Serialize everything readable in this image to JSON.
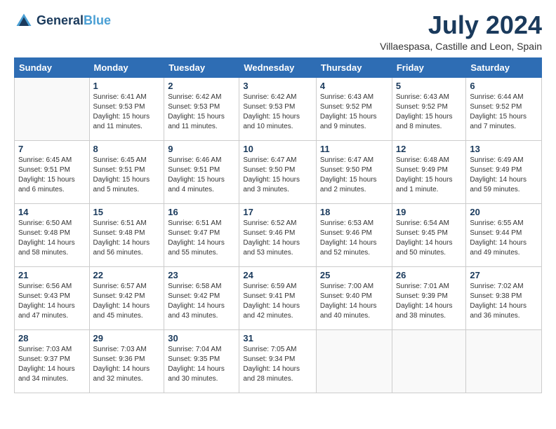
{
  "header": {
    "logo_line1": "General",
    "logo_line2": "Blue",
    "title": "July 2024",
    "subtitle": "Villaespasa, Castille and Leon, Spain"
  },
  "columns": [
    "Sunday",
    "Monday",
    "Tuesday",
    "Wednesday",
    "Thursday",
    "Friday",
    "Saturday"
  ],
  "weeks": [
    [
      {
        "day": "",
        "info": ""
      },
      {
        "day": "1",
        "info": "Sunrise: 6:41 AM\nSunset: 9:53 PM\nDaylight: 15 hours\nand 11 minutes."
      },
      {
        "day": "2",
        "info": "Sunrise: 6:42 AM\nSunset: 9:53 PM\nDaylight: 15 hours\nand 11 minutes."
      },
      {
        "day": "3",
        "info": "Sunrise: 6:42 AM\nSunset: 9:53 PM\nDaylight: 15 hours\nand 10 minutes."
      },
      {
        "day": "4",
        "info": "Sunrise: 6:43 AM\nSunset: 9:52 PM\nDaylight: 15 hours\nand 9 minutes."
      },
      {
        "day": "5",
        "info": "Sunrise: 6:43 AM\nSunset: 9:52 PM\nDaylight: 15 hours\nand 8 minutes."
      },
      {
        "day": "6",
        "info": "Sunrise: 6:44 AM\nSunset: 9:52 PM\nDaylight: 15 hours\nand 7 minutes."
      }
    ],
    [
      {
        "day": "7",
        "info": "Sunrise: 6:45 AM\nSunset: 9:51 PM\nDaylight: 15 hours\nand 6 minutes."
      },
      {
        "day": "8",
        "info": "Sunrise: 6:45 AM\nSunset: 9:51 PM\nDaylight: 15 hours\nand 5 minutes."
      },
      {
        "day": "9",
        "info": "Sunrise: 6:46 AM\nSunset: 9:51 PM\nDaylight: 15 hours\nand 4 minutes."
      },
      {
        "day": "10",
        "info": "Sunrise: 6:47 AM\nSunset: 9:50 PM\nDaylight: 15 hours\nand 3 minutes."
      },
      {
        "day": "11",
        "info": "Sunrise: 6:47 AM\nSunset: 9:50 PM\nDaylight: 15 hours\nand 2 minutes."
      },
      {
        "day": "12",
        "info": "Sunrise: 6:48 AM\nSunset: 9:49 PM\nDaylight: 15 hours\nand 1 minute."
      },
      {
        "day": "13",
        "info": "Sunrise: 6:49 AM\nSunset: 9:49 PM\nDaylight: 14 hours\nand 59 minutes."
      }
    ],
    [
      {
        "day": "14",
        "info": "Sunrise: 6:50 AM\nSunset: 9:48 PM\nDaylight: 14 hours\nand 58 minutes."
      },
      {
        "day": "15",
        "info": "Sunrise: 6:51 AM\nSunset: 9:48 PM\nDaylight: 14 hours\nand 56 minutes."
      },
      {
        "day": "16",
        "info": "Sunrise: 6:51 AM\nSunset: 9:47 PM\nDaylight: 14 hours\nand 55 minutes."
      },
      {
        "day": "17",
        "info": "Sunrise: 6:52 AM\nSunset: 9:46 PM\nDaylight: 14 hours\nand 53 minutes."
      },
      {
        "day": "18",
        "info": "Sunrise: 6:53 AM\nSunset: 9:46 PM\nDaylight: 14 hours\nand 52 minutes."
      },
      {
        "day": "19",
        "info": "Sunrise: 6:54 AM\nSunset: 9:45 PM\nDaylight: 14 hours\nand 50 minutes."
      },
      {
        "day": "20",
        "info": "Sunrise: 6:55 AM\nSunset: 9:44 PM\nDaylight: 14 hours\nand 49 minutes."
      }
    ],
    [
      {
        "day": "21",
        "info": "Sunrise: 6:56 AM\nSunset: 9:43 PM\nDaylight: 14 hours\nand 47 minutes."
      },
      {
        "day": "22",
        "info": "Sunrise: 6:57 AM\nSunset: 9:42 PM\nDaylight: 14 hours\nand 45 minutes."
      },
      {
        "day": "23",
        "info": "Sunrise: 6:58 AM\nSunset: 9:42 PM\nDaylight: 14 hours\nand 43 minutes."
      },
      {
        "day": "24",
        "info": "Sunrise: 6:59 AM\nSunset: 9:41 PM\nDaylight: 14 hours\nand 42 minutes."
      },
      {
        "day": "25",
        "info": "Sunrise: 7:00 AM\nSunset: 9:40 PM\nDaylight: 14 hours\nand 40 minutes."
      },
      {
        "day": "26",
        "info": "Sunrise: 7:01 AM\nSunset: 9:39 PM\nDaylight: 14 hours\nand 38 minutes."
      },
      {
        "day": "27",
        "info": "Sunrise: 7:02 AM\nSunset: 9:38 PM\nDaylight: 14 hours\nand 36 minutes."
      }
    ],
    [
      {
        "day": "28",
        "info": "Sunrise: 7:03 AM\nSunset: 9:37 PM\nDaylight: 14 hours\nand 34 minutes."
      },
      {
        "day": "29",
        "info": "Sunrise: 7:03 AM\nSunset: 9:36 PM\nDaylight: 14 hours\nand 32 minutes."
      },
      {
        "day": "30",
        "info": "Sunrise: 7:04 AM\nSunset: 9:35 PM\nDaylight: 14 hours\nand 30 minutes."
      },
      {
        "day": "31",
        "info": "Sunrise: 7:05 AM\nSunset: 9:34 PM\nDaylight: 14 hours\nand 28 minutes."
      },
      {
        "day": "",
        "info": ""
      },
      {
        "day": "",
        "info": ""
      },
      {
        "day": "",
        "info": ""
      }
    ]
  ]
}
